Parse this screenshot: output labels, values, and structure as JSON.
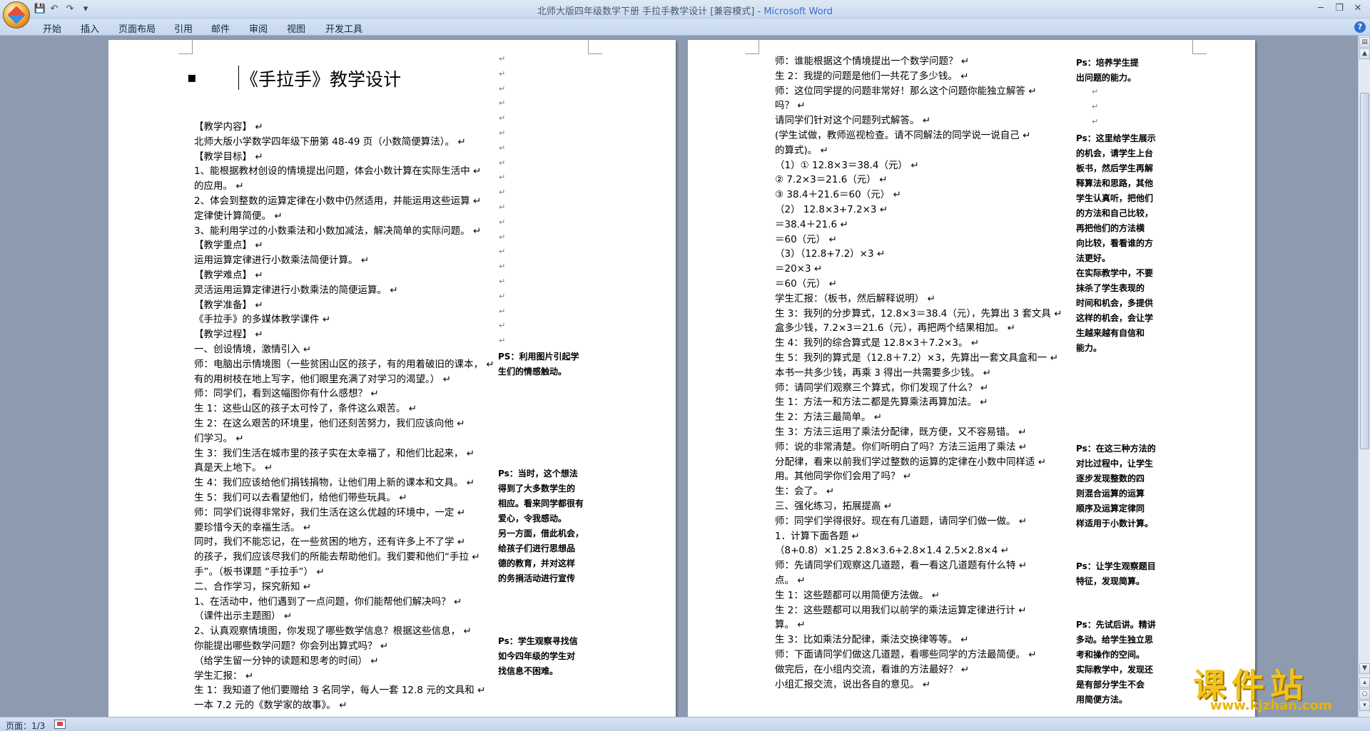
{
  "window": {
    "title_doc": "北师大版四年级数学下册  手拉手教学设计 [兼容模式] - ",
    "title_app": "Microsoft Word"
  },
  "qat": {
    "save": "💾",
    "undo": "↶",
    "redo": "↷",
    "customize": "▾"
  },
  "ribbon": {
    "tabs": [
      "开始",
      "插入",
      "页面布局",
      "引用",
      "邮件",
      "审阅",
      "视图",
      "开发工具"
    ]
  },
  "window_controls": {
    "minimize": "─",
    "restore": "❐",
    "close": "✕"
  },
  "left_page": {
    "bullet": "▪",
    "title": "《手拉手》教学设计",
    "lines": [
      "【教学内容】",
      "  北师大版小学数学四年级下册第 48-49 页（小数简便算法）。",
      "【教学目标】",
      "1、能根据教材创设的情境提出问题，体会小数计算在实际生活中",
      "的应用。",
      "2、体会到整数的运算定律在小数中仍然适用，并能运用这些运算",
      "定律使计算简便。",
      "3、能利用学过的小数乘法和小数加减法，解决简单的实际问题。",
      "【教学重点】",
      "运用运算定律进行小数乘法简便计算。",
      "【教学难点】",
      "灵活运用运算定律进行小数乘法的简便运算。",
      "【教学准备】",
      "《手拉手》的多媒体教学课件",
      "【教学过程】",
      "一、创设情境，激情引入",
      "师：电脑出示情境图（一些贫困山区的孩子，有的用着破旧的课本，",
      "有的用树枝在地上写字，他们眼里充满了对学习的渴望。）",
      "      师：同学们，看到这幅图你有什么感想？",
      "         生 1：这些山区的孩子太可怜了，条件这么艰苦。",
      "         生 2：在这么艰苦的环境里，他们还刻苦努力，我们应该向他",
      "们学习。",
      "         生 3：我们生活在城市里的孩子实在太幸福了，和他们比起来，",
      "真是天上地下。",
      "         生 4：我们应该给他们捐钱捐物，让他们用上新的课本和文具。",
      "         生 5：我们可以去看望他们，给他们带些玩具。",
      "         师：同学们说得非常好，我们生活在这么优越的环境中，一定",
      "要珍惜今天的幸福生活。",
      "         同时，我们不能忘记，在一些贫困的地方，还有许多上不了学",
      "的孩子，我们应该尽我们的所能去帮助他们。我们要和他们“手拉",
      "手”。（板书课题 “手拉手”）",
      "   二、合作学习，探究新知",
      "   1、在活动中，他们遇到了一点问题，你们能帮他们解决吗？",
      "     （课件出示主题图）",
      "   2、认真观察情境图，你发现了哪些数学信息？根据这些信息，",
      "你能提出哪些数学问题？你会列出算式吗？",
      "     （给学生留一分钟的读题和思考的时间）",
      "学生汇报：",
      "   生 1：我知道了他们要赠给 3 名同学，每人一套 12.8 元的文具和",
      "一本 7.2 元的《数学家的故事》。"
    ],
    "notes": [
      [
        "PS：利用图片引起学",
        "生们的情感触动。"
      ],
      [
        "Ps：当时，这个想法",
        "得到了大多数学生的",
        "相应。看来同学都很有",
        "爱心，令我感动。",
        "另一方面，借此机会，",
        "给孩子们进行思想品",
        "德的教育，并对这样",
        "的务捐活动进行宣传"
      ],
      [
        "Ps：学生观察寻找信",
        "如今四年级的学生对",
        "找信息不困难。"
      ]
    ]
  },
  "right_page": {
    "lines": [
      "  师：谁能根据这个情境提出一个数学问题？",
      "  生 2：我提的问题是他们一共花了多少钱。",
      "  师：这位同学提的问题非常好！那么这个问题你能独立解答",
      "吗？",
      "      请同学们针对这个问题列式解答。",
      "      (学生试做，教师巡视检查。请不同解法的同学说一说自己",
      "的算式)。",
      "    （1）① 12.8×3＝38.4（元）",
      "           ② 7.2×3＝21.6（元）",
      "           ③ 38.4＋21.6＝60（元）",
      "    （2） 12.8×3+7.2×3",
      "          ＝38.4＋21.6",
      "          ＝60（元）",
      "    （3）（12.8+7.2）×3",
      "          ＝20×3",
      "          ＝60（元）",
      "    学生汇报：（板书，然后解释说明）",
      "    生 3：我列的分步算式，12.8×3＝38.4（元），先算出 3 套文具",
      "盒多少钱，7.2×3＝21.6（元），再把两个结果相加。",
      "    生 4：我列的综合算式是 12.8×3＋7.2×3。",
      "    生 5：我列的算式是（12.8＋7.2）×3，先算出一套文具盒和一",
      "本书一共多少钱，再乘 3 得出一共需要多少钱。",
      "      师：请同学们观察三个算式，你们发现了什么？",
      "      生 1：方法一和方法二都是先算乘法再算加法。",
      "      生 2：方法三最简单。",
      "      生 3：方法三运用了乘法分配律，既方便，又不容易错。",
      "      师：说的非常清楚。你们听明白了吗？方法三运用了乘法",
      "分配律，看来以前我们学过整数的运算的定律在小数中同样适",
      "用。其他同学你们会用了吗？",
      "      生：会了。",
      "      三、强化练习，拓展提高",
      "      师：同学们学得很好。现在有几道题，请同学们做一做。",
      "      1．计算下面各题",
      "      （8+0.8）×1.25    2.8×3.6+2.8×1.4    2.5×2.8×4",
      "      师：先请同学们观察这几道题，看一看这几道题有什么特",
      "点。",
      "      生 1：这些题都可以用简便方法做。",
      "      生 2：这些题都可以用我们以前学的乘法运算定律进行计",
      "算。",
      "      生 3：比如乘法分配律，乘法交换律等等。",
      "      师：下面请同学们做这几道题，看哪些同学的方法最简便。",
      "做完后，在小组内交流，看谁的方法最好？",
      "      小组汇报交流，说出各自的意见。"
    ],
    "notes": [
      [
        "Ps：培养学生提",
        "出问题的能力。"
      ],
      [
        "Ps：这里给学生展示",
        "的机会，请学生上台",
        "板书，然后学生再解",
        "释算法和思路，其他",
        "学生认真听，把他们",
        "的方法和自己比较，",
        "再把他们的方法横",
        "向比较，看看谁的方",
        "法更好。",
        "在实际教学中，不要",
        "抹杀了学生表现的",
        "时间和机会，多提供",
        "这样的机会，会让学",
        "生越来越有自信和",
        "能力。"
      ],
      [
        "Ps：在这三种方法的",
        "对比过程中，让学生",
        "逐步发现整数的四",
        "则混合运算的运算",
        "顺序及运算定律同",
        "样适用于小数计算。"
      ],
      [
        "Ps：让学生观察题目",
        "特征，发现简算。"
      ],
      [
        "Ps：先试后讲。精讲",
        "多动。给学生独立思",
        "考和操作的空间。",
        "实际教学中，发现还",
        "是有部分学生不会",
        "用简便方法。"
      ]
    ]
  },
  "status": {
    "page": "页面：1/3"
  },
  "watermark": {
    "title": "课件站",
    "url": "www.kjzhan.com"
  }
}
